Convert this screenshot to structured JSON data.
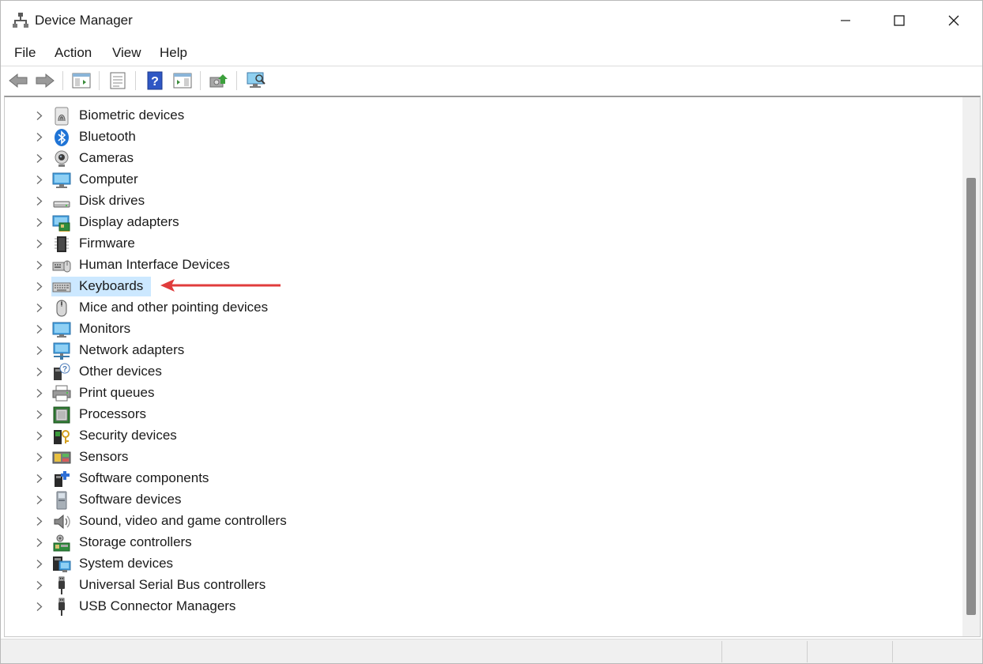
{
  "window": {
    "title": "Device Manager"
  },
  "menu": {
    "items": [
      "File",
      "Action",
      "View",
      "Help"
    ]
  },
  "toolbar": {
    "buttons": [
      "back-icon",
      "forward-icon",
      "show-hide-console-tree-icon",
      "properties-icon",
      "help-icon",
      "action-pane-icon",
      "update-driver-icon",
      "scan-hardware-icon"
    ]
  },
  "tree": {
    "selected": "Keyboards",
    "items": [
      {
        "label": "Biometric devices",
        "icon": "fingerprint-icon"
      },
      {
        "label": "Bluetooth",
        "icon": "bluetooth-icon"
      },
      {
        "label": "Cameras",
        "icon": "camera-icon"
      },
      {
        "label": "Computer",
        "icon": "computer-icon"
      },
      {
        "label": "Disk drives",
        "icon": "disk-drive-icon"
      },
      {
        "label": "Display adapters",
        "icon": "display-adapter-icon"
      },
      {
        "label": "Firmware",
        "icon": "firmware-chip-icon"
      },
      {
        "label": "Human Interface Devices",
        "icon": "hid-icon"
      },
      {
        "label": "Keyboards",
        "icon": "keyboard-icon"
      },
      {
        "label": "Mice and other pointing devices",
        "icon": "mouse-icon"
      },
      {
        "label": "Monitors",
        "icon": "monitor-icon"
      },
      {
        "label": "Network adapters",
        "icon": "network-adapter-icon"
      },
      {
        "label": "Other devices",
        "icon": "unknown-device-icon"
      },
      {
        "label": "Print queues",
        "icon": "printer-icon"
      },
      {
        "label": "Processors",
        "icon": "processor-icon"
      },
      {
        "label": "Security devices",
        "icon": "security-key-icon"
      },
      {
        "label": "Sensors",
        "icon": "sensor-icon"
      },
      {
        "label": "Software components",
        "icon": "software-component-icon"
      },
      {
        "label": "Software devices",
        "icon": "software-device-icon"
      },
      {
        "label": "Sound, video and game controllers",
        "icon": "speaker-icon"
      },
      {
        "label": "Storage controllers",
        "icon": "storage-controller-icon"
      },
      {
        "label": "System devices",
        "icon": "system-device-icon"
      },
      {
        "label": "Universal Serial Bus controllers",
        "icon": "usb-icon"
      },
      {
        "label": "USB Connector Managers",
        "icon": "usb-connector-icon"
      }
    ]
  },
  "colors": {
    "selection": "#cce8ff",
    "annotation_arrow": "#e03c3c"
  }
}
